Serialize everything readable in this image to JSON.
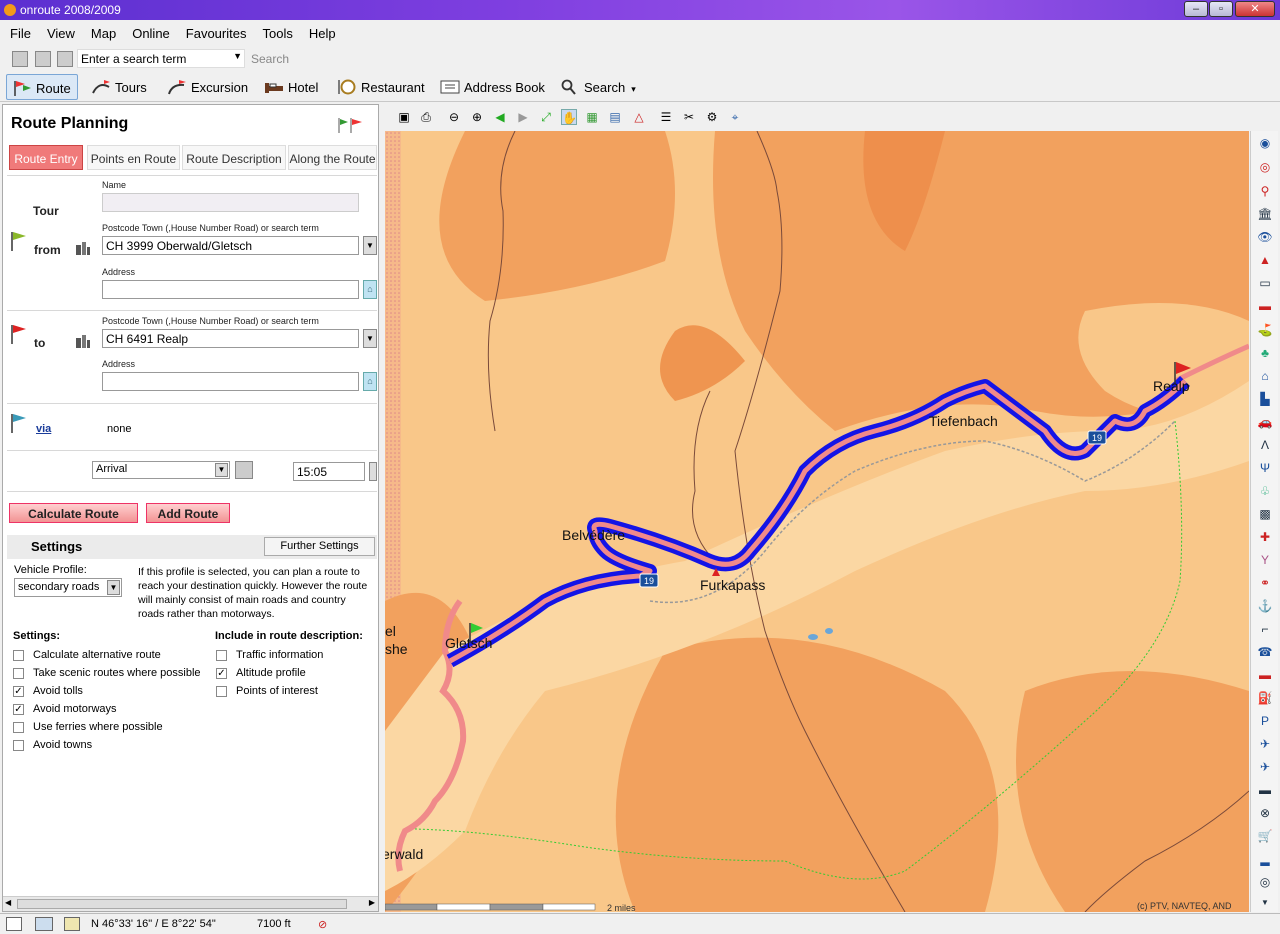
{
  "window": {
    "title": "onroute 2008/2009"
  },
  "menu": [
    "File",
    "View",
    "Map",
    "Online",
    "Favourites",
    "Tools",
    "Help"
  ],
  "search": {
    "placeholder": "Enter a search term",
    "button": "Search"
  },
  "toolbar": {
    "route": "Route",
    "tours": "Tours",
    "excursion": "Excursion",
    "hotel": "Hotel",
    "restaurant": "Restaurant",
    "address_book": "Address Book",
    "search": "Search"
  },
  "panel": {
    "title": "Route Planning",
    "tabs": [
      "Route Entry",
      "Points en Route",
      "Route Description",
      "Along the Route"
    ],
    "tour_label": "Tour",
    "name_label": "Name",
    "name_value": "",
    "from_label": "from",
    "to_label": "to",
    "via_label": "via",
    "postcode_label": "Postcode Town (,House Number Road) or search term",
    "address_label": "Address",
    "from_value": "CH 3999 Oberwald/Gletsch",
    "from_address": "",
    "to_value": "CH 6491 Realp",
    "to_address": "",
    "via_value": "none",
    "arrival": "Arrival",
    "time": "15:05",
    "calculate_button": "Calculate Route",
    "add_button": "Add Route"
  },
  "settings": {
    "title": "Settings",
    "further_button": "Further Settings",
    "vehicle_label": "Vehicle Profile:",
    "vehicle_value": "secondary roads",
    "profile_text": "If this profile is selected, you can plan a route to reach your destination quickly. However the route will mainly consist of main roads and country roads rather than motorways.",
    "settings_label": "Settings:",
    "include_label": "Include in route description:",
    "options": [
      {
        "label": "Calculate alternative route",
        "checked": false
      },
      {
        "label": "Take scenic routes where possible",
        "checked": false
      },
      {
        "label": "Avoid tolls",
        "checked": true
      },
      {
        "label": "Avoid motorways",
        "checked": true
      },
      {
        "label": "Use ferries where possible",
        "checked": false
      },
      {
        "label": "Avoid towns",
        "checked": false
      }
    ],
    "include": [
      {
        "label": "Traffic information",
        "checked": false
      },
      {
        "label": "Altitude profile",
        "checked": true
      },
      {
        "label": "Points of interest",
        "checked": false
      }
    ]
  },
  "map": {
    "places": [
      "Belvédère",
      "Furkapass",
      "Tiefenbach",
      "Realp",
      "Gletsch",
      "erwald",
      "el",
      "she"
    ],
    "road_number": "19",
    "scale": "2 miles",
    "copyright": "(c) PTV, NAVTEQ, AND"
  },
  "status": {
    "coords": "N 46°33' 16\" / E 8°22' 54\"",
    "altitude": "7100 ft"
  },
  "colors": {
    "route_blue": "#1414e6",
    "route_pink": "#f08a8a",
    "terrain_light": "#f9c789",
    "terrain_dark": "#f2a15e",
    "tab_active": "#f07a7a"
  }
}
